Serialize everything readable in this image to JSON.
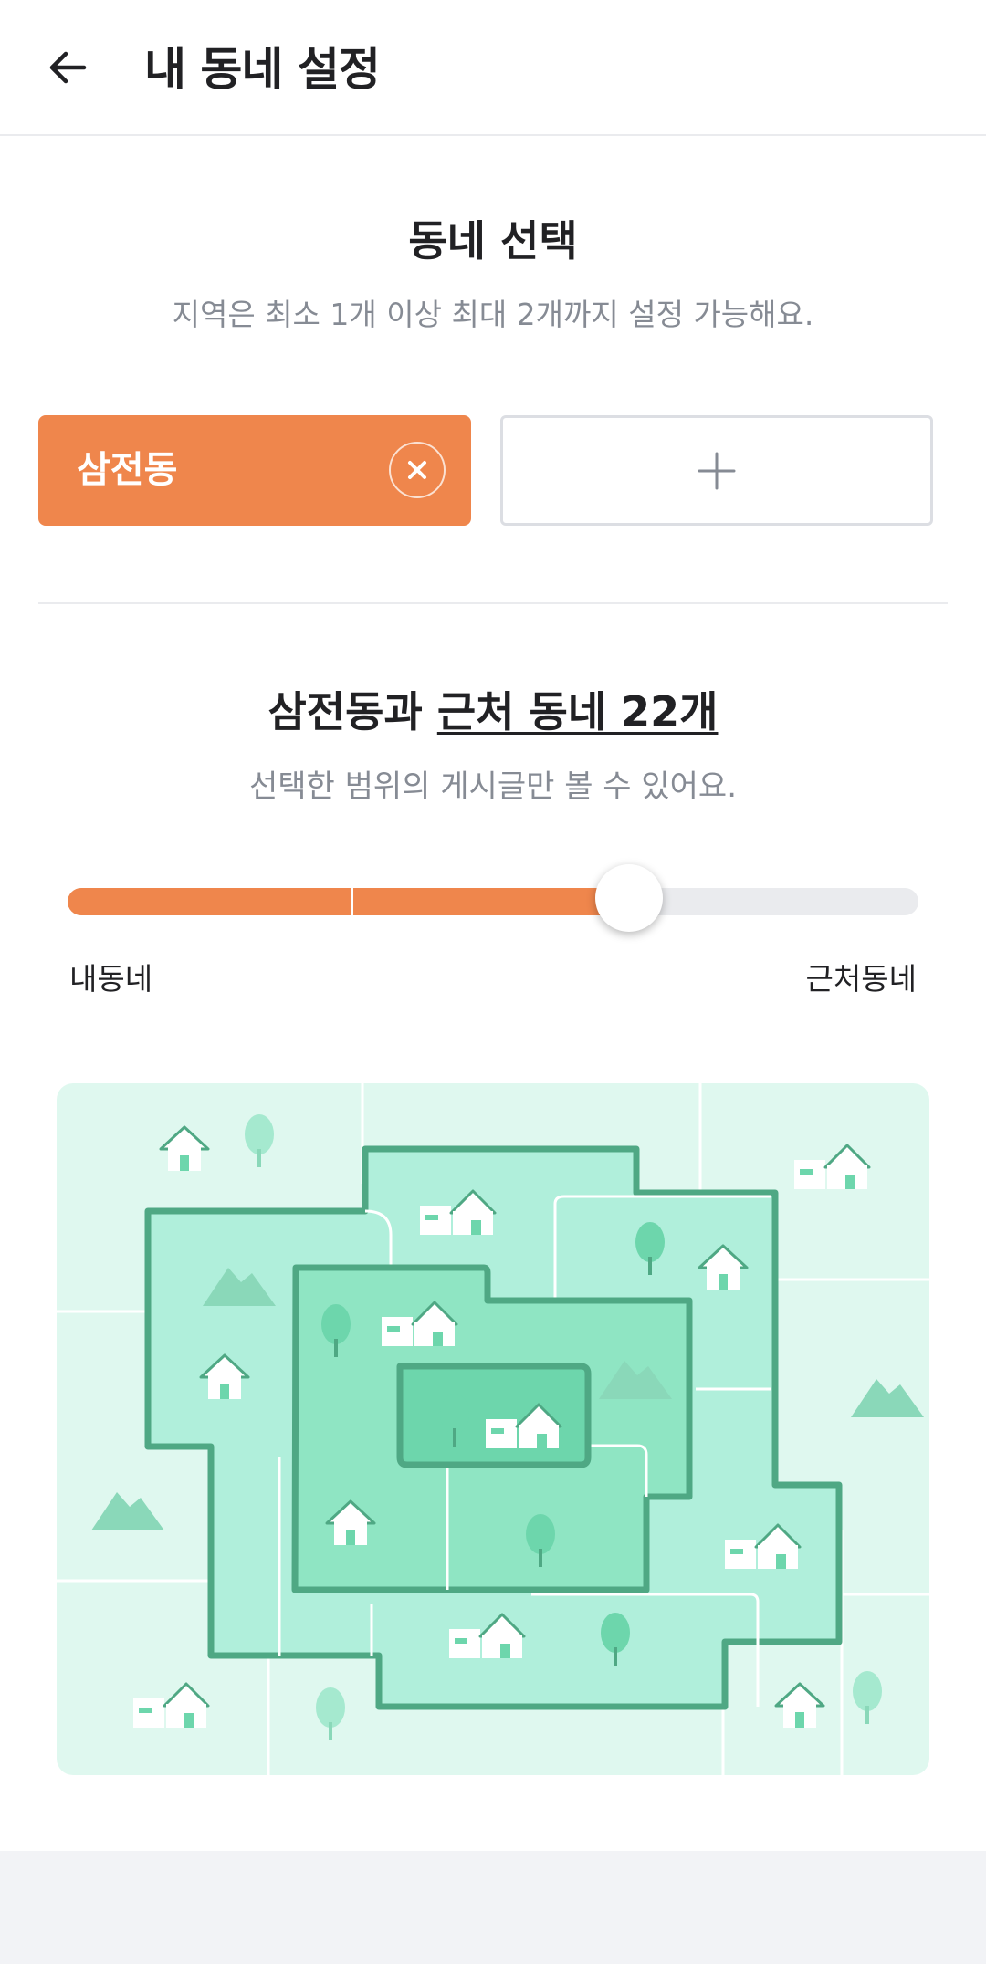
{
  "header": {
    "title": "내 동네 설정",
    "back_icon": "arrow-left-icon"
  },
  "neighborhood_select": {
    "title": "동네 선택",
    "subtitle": "지역은 최소 1개 이상 최대 2개까지 설정 가능해요.",
    "selected": [
      {
        "label": "삼전동",
        "remove_icon": "close-icon"
      }
    ],
    "add_icon": "plus-icon"
  },
  "range": {
    "title_prefix": "삼전동과 ",
    "title_link": "근처 동네 22개",
    "subtitle": "선택한 범위의 게시글만 볼 수 있어요.",
    "slider": {
      "level": 0.66,
      "steps": 3,
      "min_label": "내동네",
      "max_label": "근처동네"
    },
    "illustration": "neighborhood-range-map"
  },
  "colors": {
    "accent": "#ef864c",
    "track": "#eaebee",
    "text_primary": "#212124",
    "text_secondary": "#868b94",
    "map_base": "#dff8ef",
    "map_outer": "#b0efdb",
    "map_middle": "#8fe5c3",
    "map_inner": "#6dd6ac",
    "map_stroke": "#4fa884"
  }
}
